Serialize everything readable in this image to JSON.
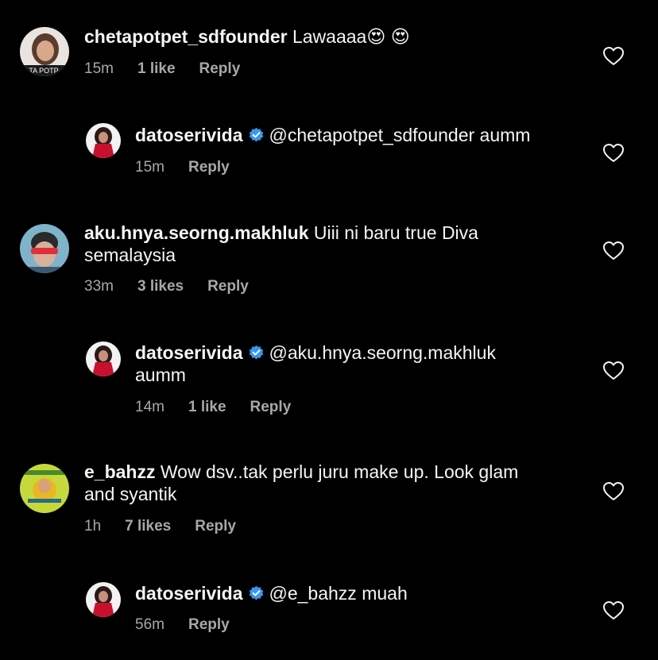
{
  "comments": [
    {
      "username": "chetapotpet_sdfounder",
      "text": "Lawaaaa",
      "emoji": "😍 😍",
      "time": "15m",
      "likes": "1 like",
      "reply_label": "Reply"
    },
    {
      "username": "datoserivida",
      "verified": true,
      "text": "@chetapotpet_sdfounder aumm",
      "time": "15m",
      "reply_label": "Reply"
    },
    {
      "username": "aku.hnya.seorng.makhluk",
      "text": "Uiii ni baru true Diva",
      "text_line2": "semalaysia",
      "time": "33m",
      "likes": "3 likes",
      "reply_label": "Reply"
    },
    {
      "username": "datoserivida",
      "verified": true,
      "text": "@aku.hnya.seorng.makhluk",
      "text_line2": "aumm",
      "time": "14m",
      "likes": "1 like",
      "reply_label": "Reply"
    },
    {
      "username": "e_bahzz",
      "text": "Wow dsv..tak perlu juru make up. Look glam",
      "text_line2": "and syantik",
      "time": "1h",
      "likes": "7 likes",
      "reply_label": "Reply"
    },
    {
      "username": "datoserivida",
      "verified": true,
      "text": "@e_bahzz muah",
      "time": "56m",
      "reply_label": "Reply"
    }
  ],
  "colors": {
    "background": "#000000",
    "text": "#f5f5f5",
    "meta": "#a8a8a8",
    "verified": "#3897f0"
  },
  "icons": {
    "like": "heart-outline-icon",
    "verified": "verified-badge-icon"
  }
}
